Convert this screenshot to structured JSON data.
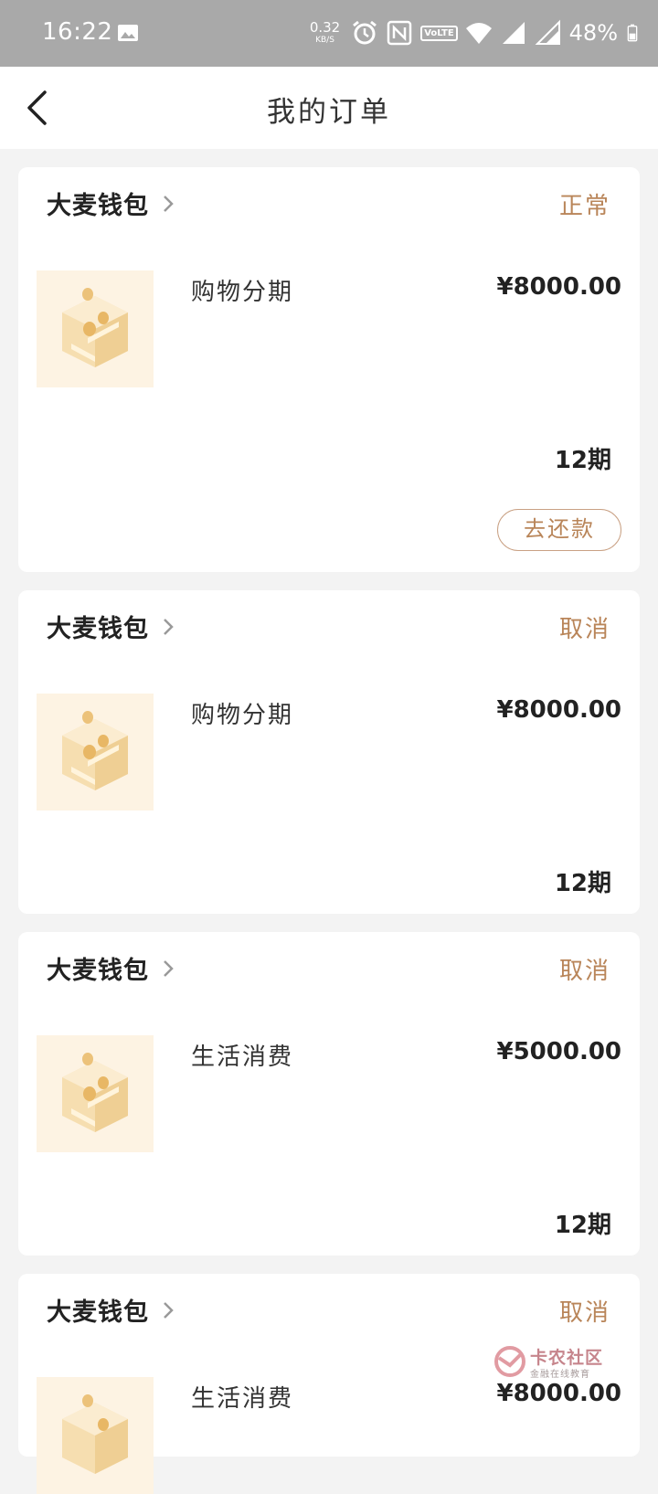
{
  "status_bar": {
    "time": "16:22",
    "speed_value": "0.32",
    "speed_unit": "KB/S",
    "volte_label": "VoLTE",
    "battery": "48%"
  },
  "header": {
    "title": "我的订单"
  },
  "orders": [
    {
      "merchant": "大麦钱包",
      "status": "正常",
      "product": "购物分期",
      "amount": "¥8000.00",
      "periods": "12期",
      "action_label": "去还款"
    },
    {
      "merchant": "大麦钱包",
      "status": "取消",
      "product": "购物分期",
      "amount": "¥8000.00",
      "periods": "12期"
    },
    {
      "merchant": "大麦钱包",
      "status": "取消",
      "product": "生活消费",
      "amount": "¥5000.00",
      "periods": "12期"
    },
    {
      "merchant": "大麦钱包",
      "status": "取消",
      "product": "生活消费",
      "amount": "¥8000.00"
    }
  ],
  "watermark": {
    "name": "卡农社区",
    "subtitle": "金融在线教育"
  },
  "colors": {
    "status_bar": "#a9a9a9",
    "accent": "#b98559",
    "thumb_bg": "#fdf3e3",
    "page_bg": "#f3f3f3"
  },
  "icons": [
    "gallery-icon",
    "alarm-icon",
    "nfc-icon",
    "wifi-icon",
    "signal-icon",
    "battery-icon",
    "back-arrow-icon",
    "chevron-right-icon",
    "coin-box-icon"
  ]
}
